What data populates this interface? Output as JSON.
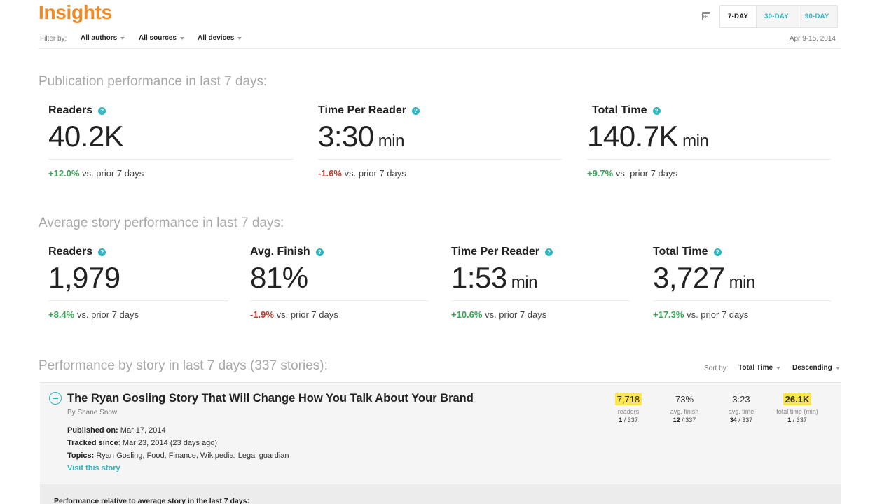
{
  "header": {
    "title": "Insights",
    "filter_label": "Filter by:",
    "filters": [
      "All authors",
      "All sources",
      "All devices"
    ],
    "ranges": [
      "7-DAY",
      "30-DAY",
      "90-DAY"
    ],
    "active_range": "7-DAY",
    "date_range": "Apr 9-15, 2014"
  },
  "publication": {
    "title": "Publication performance in last 7 days:",
    "metrics": [
      {
        "label": "Readers",
        "value": "40.2K",
        "unit": "",
        "change": "+12.0%",
        "change_type": "pos",
        "suffix": "vs. prior 7 days"
      },
      {
        "label": "Time Per Reader",
        "value": "3:30",
        "unit": "min",
        "change": "-1.6%",
        "change_type": "neg",
        "suffix": "vs. prior 7 days"
      },
      {
        "label": "Total Time",
        "value": "140.7K",
        "unit": "min",
        "change": "+9.7%",
        "change_type": "pos",
        "suffix": "vs. prior 7 days"
      }
    ]
  },
  "average": {
    "title": "Average story performance in last 7 days:",
    "metrics": [
      {
        "label": "Readers",
        "value": "1,979",
        "unit": "",
        "change": "+8.4%",
        "change_type": "pos",
        "suffix": "vs. prior 7 days"
      },
      {
        "label": "Avg. Finish",
        "value": "81%",
        "unit": "",
        "change": "-1.9%",
        "change_type": "neg",
        "suffix": "vs. prior 7 days"
      },
      {
        "label": "Time Per Reader",
        "value": "1:53",
        "unit": "min",
        "change": "+10.6%",
        "change_type": "pos",
        "suffix": "vs. prior 7 days"
      },
      {
        "label": "Total Time",
        "value": "3,727",
        "unit": "min",
        "change": "+17.3%",
        "change_type": "pos",
        "suffix": "vs. prior 7 days"
      }
    ]
  },
  "stories": {
    "title": "Performance by story in last 7 days (337 stories):",
    "sort_label": "Sort by:",
    "sort_field": "Total Time",
    "sort_order": "Descending",
    "story": {
      "title": "The Ryan Gosling Story That Will Change How You Talk About Your Brand",
      "byline": "By Shane Snow",
      "published_label": "Published on:",
      "published": "Mar 17, 2014",
      "tracked_label": "Tracked since",
      "tracked": ": Mar 23, 2014 (23 days ago)",
      "topics_label": "Topics:",
      "topics": "Ryan Gosling, Food, Finance, Wikipedia, Legal guardian",
      "visit": "Visit this story",
      "stats": [
        {
          "value": "7,718",
          "label": "readers",
          "rank": "1",
          "total": "/ 337"
        },
        {
          "value": "73%",
          "label": "avg. finish",
          "rank": "12",
          "total": "/ 337"
        },
        {
          "value": "3:23",
          "label": "avg. time",
          "rank": "34",
          "total": "/ 337"
        },
        {
          "value": "26.1K",
          "label": "total time (min)",
          "rank": "1",
          "total": "/ 337"
        }
      ]
    },
    "relative_title": "Performance relative to average story in the last 7 days:"
  },
  "colors": {
    "brand": "#f08a24",
    "accent": "#2eb6c3",
    "positive": "#34a853",
    "negative": "#c0392b",
    "highlight": "#fde54a"
  }
}
